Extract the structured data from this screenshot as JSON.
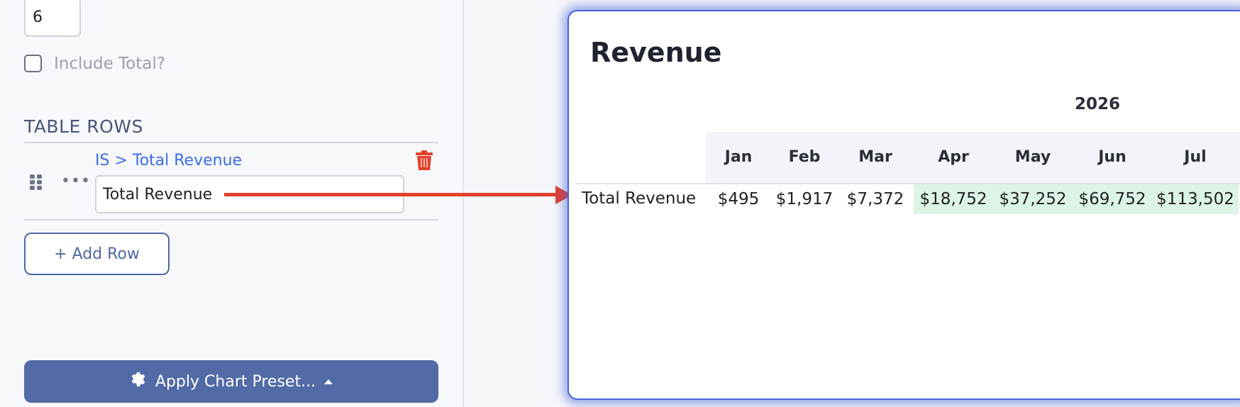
{
  "settings": {
    "count_value": "6",
    "include_total_label": "Include Total?",
    "include_total_checked": false
  },
  "table_rows": {
    "section_title": "TABLE ROWS",
    "rows": [
      {
        "path": "IS > Total Revenue",
        "label_value": "Total Revenue"
      }
    ],
    "add_row_label": "+ Add Row"
  },
  "apply_preset_label": "Apply Chart Preset...",
  "preview": {
    "title": "Revenue",
    "year": "2026",
    "months": [
      "Jan",
      "Feb",
      "Mar",
      "Apr",
      "May",
      "Jun",
      "Jul"
    ],
    "rows": [
      {
        "label": "Total Revenue",
        "values": [
          "$495",
          "$1,917",
          "$7,372",
          "$18,752",
          "$37,252",
          "$69,752",
          "$113,502"
        ]
      }
    ]
  },
  "colors": {
    "accent": "#526aa6",
    "link": "#3a6ee3",
    "danger": "#e0412b",
    "highlight": "#dcf4e6",
    "card_border": "#4a63d8"
  }
}
